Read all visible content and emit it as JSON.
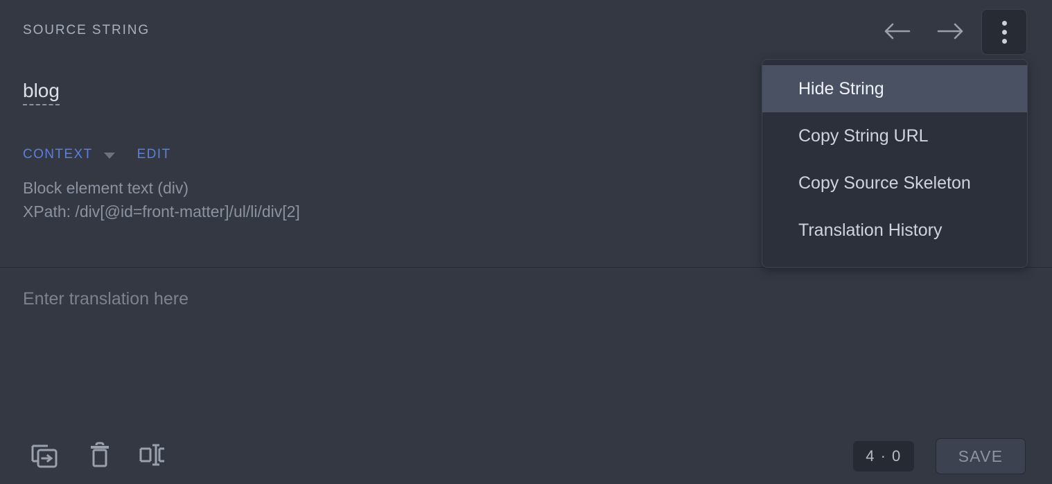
{
  "header": {
    "title": "SOURCE STRING",
    "prev_icon": "arrow-left-icon",
    "next_icon": "arrow-right-icon",
    "menu_icon": "kebab-menu-icon"
  },
  "menu": {
    "items": [
      {
        "label": "Hide String",
        "active": true
      },
      {
        "label": "Copy String URL",
        "active": false
      },
      {
        "label": "Copy Source Skeleton",
        "active": false
      },
      {
        "label": "Translation History",
        "active": false
      }
    ]
  },
  "source": {
    "text": "blog",
    "context_label": "CONTEXT",
    "edit_label": "EDIT",
    "details": [
      "Block element text (div)",
      "XPath: /div[@id=front-matter]/ul/li/div[2]"
    ]
  },
  "translation": {
    "value": "",
    "placeholder": "Enter translation here"
  },
  "toolbar": {
    "copy_icon": "copy-source-icon",
    "delete_icon": "trash-icon",
    "split_icon": "split-string-icon",
    "count_badge": "4 · 0",
    "save_label": "SAVE"
  },
  "colors": {
    "background": "#333843",
    "panel": "#2b303b",
    "accent": "#5b7fe0",
    "menu_highlight": "#4a5162",
    "muted_text": "#8b93a1"
  }
}
